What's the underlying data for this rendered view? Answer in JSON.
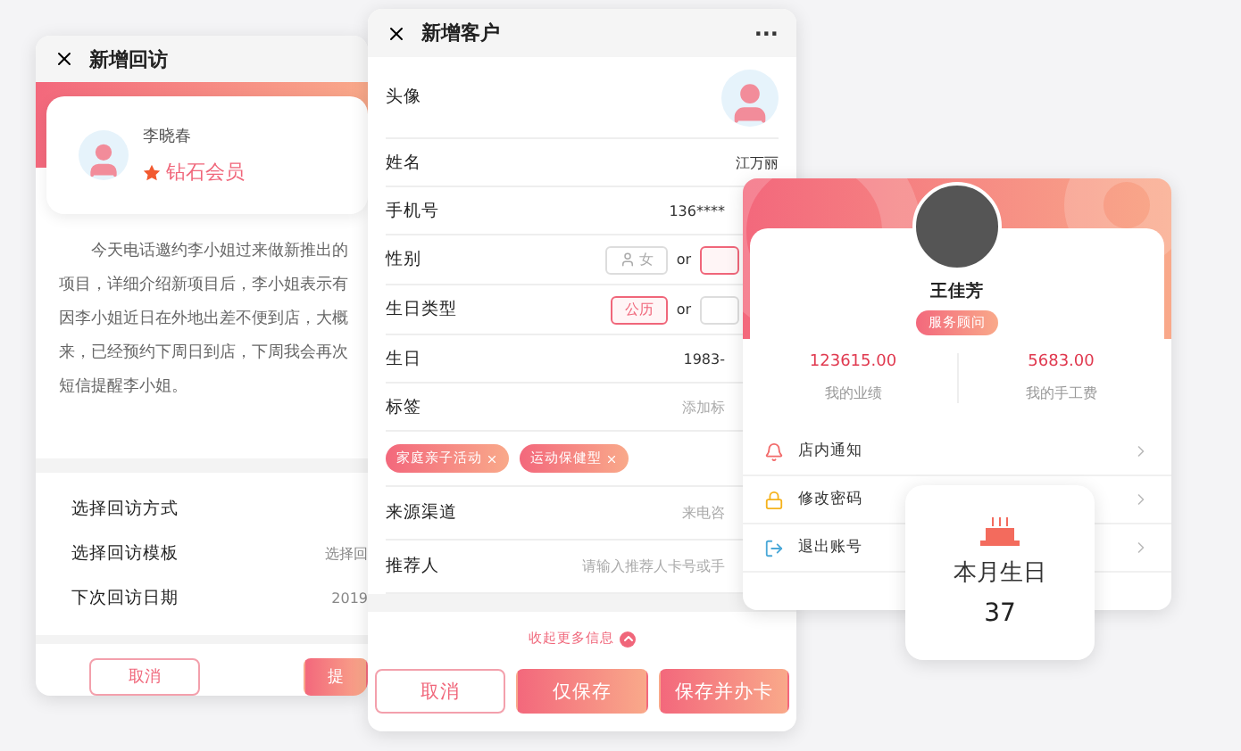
{
  "visit_form": {
    "title": "新增回访",
    "member": {
      "name": "李晓春",
      "level": "钻石会员"
    },
    "note_lines": [
      "今天电话邀约李小姐过来做新推出的",
      "项目，详细介绍新项目后，李小姐表示有",
      "因李小姐近日在外地出差不便到店，大概",
      "来，已经预约下周日到店，下周我会再次",
      "短信提醒李小姐。"
    ],
    "rows": [
      {
        "label": "选择回访方式"
      },
      {
        "label": "选择回访模板",
        "value": "选择回"
      },
      {
        "label": "下次回访日期",
        "value": "2019"
      }
    ],
    "buttons": [
      {
        "label": "取消",
        "kind": "outline"
      },
      {
        "label": "提",
        "kind": "primary"
      }
    ]
  },
  "customer_form": {
    "title": "新增客户",
    "more": "···",
    "fields": [
      {
        "kind": "avatar",
        "label": "头像"
      },
      {
        "kind": "text",
        "label": "姓名",
        "value": "江万丽"
      },
      {
        "kind": "text",
        "label": "手机号",
        "value": "136****"
      },
      {
        "kind": "choice",
        "label": "性别",
        "separator": "or",
        "options": [
          {
            "label": "女",
            "icon": true,
            "selected": false
          },
          {
            "selected": true
          }
        ]
      },
      {
        "kind": "choice",
        "label": "生日类型",
        "separator": "or",
        "options": [
          {
            "label": "公历",
            "selected": true
          },
          {
            "selected": false
          }
        ]
      },
      {
        "kind": "text",
        "label": "生日",
        "value": "1983-"
      },
      {
        "kind": "text",
        "label": "标签",
        "placeholder": "添加标"
      },
      {
        "kind": "tags",
        "tags": [
          "家庭亲子活动",
          "运动保健型"
        ]
      },
      {
        "kind": "text",
        "label": "来源渠道",
        "placeholder": "来电咨"
      },
      {
        "kind": "text",
        "label": "推荐人",
        "placeholder": "请输入推荐人卡号或手"
      }
    ],
    "collapse": "收起更多信息",
    "buttons": [
      {
        "label": "取消",
        "kind": "outline"
      },
      {
        "label": "仅保存",
        "kind": "primary"
      },
      {
        "label": "保存并办卡",
        "kind": "primary"
      }
    ]
  },
  "profile": {
    "name": "王佳芳",
    "role": "服务顾问",
    "stats": [
      {
        "value": "123615.00",
        "label": "我的业绩"
      },
      {
        "value": "5683.00",
        "label": "我的手工费"
      }
    ],
    "menu": [
      {
        "kind": "notice",
        "label": "店内通知"
      },
      {
        "kind": "password",
        "label": "修改密码"
      },
      {
        "kind": "logout",
        "label": "退出账号"
      }
    ]
  },
  "birthday": {
    "title": "本月生日",
    "count": "37"
  }
}
